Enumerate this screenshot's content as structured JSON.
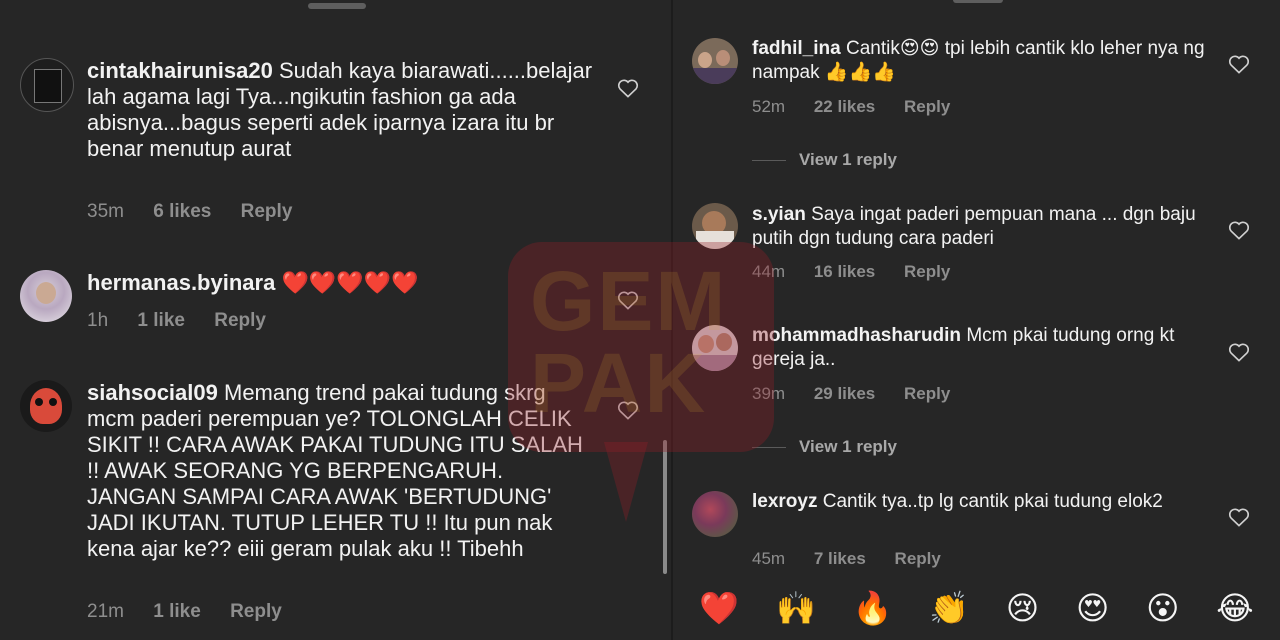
{
  "left": {
    "comments": [
      {
        "username": "cintakhairunisa20",
        "text": "Sudah kaya biarawati......belajar lah agama lagi Tya...ngikutin fashion  ga ada abisnya...bagus seperti adek iparnya izara itu br benar menutup aurat",
        "time": "35m",
        "likes": "6 likes",
        "reply": "Reply"
      },
      {
        "username": "hermanas.byinara",
        "text": "❤️❤️❤️❤️❤️",
        "time": "1h",
        "likes": "1 like",
        "reply": "Reply"
      },
      {
        "username": "siahsocial09",
        "text": "Memang trend pakai tudung skrg mcm paderi perempuan ye? TOLONGLAH CELIK SIKIT !! CARA AWAK PAKAI TUDUNG ITU  SALAH !! AWAK SEORANG YG BERPENGARUH. JANGAN SAMPAI CARA AWAK 'BERTUDUNG' JADI IKUTAN. TUTUP LEHER TU !! Itu pun nak kena ajar ke?? eiii geram pulak aku !! Tibehh",
        "time": "21m",
        "likes": "1 like",
        "reply": "Reply"
      }
    ]
  },
  "right": {
    "comments": [
      {
        "username": "fadhil_ina",
        "text": "Cantik😍😍 tpi lebih cantik klo leher nya ng nampak 👍👍👍",
        "time": "52m",
        "likes": "22 likes",
        "reply": "Reply",
        "view_replies": "View 1 reply"
      },
      {
        "username": "s.yian",
        "text": "Saya ingat paderi pempuan mana ... dgn baju putih dgn tudung cara paderi",
        "time": "44m",
        "likes": "16 likes",
        "reply": "Reply"
      },
      {
        "username": "mohammadhasharudin",
        "text": "Mcm pkai tudung orng kt  gereja ja..",
        "time": "39m",
        "likes": "29 likes",
        "reply": "Reply",
        "view_replies": "View 1 reply"
      },
      {
        "username": "lexroyz",
        "text": "Cantik tya..tp lg cantik pkai tudung elok2",
        "time": "45m",
        "likes": "7 likes",
        "reply": "Reply"
      }
    ],
    "reactions": [
      "❤️",
      "🙌",
      "🔥",
      "👏",
      "😢",
      "😍",
      "😮",
      "😂"
    ]
  },
  "watermark": {
    "text": "GEM PAK"
  },
  "colors": {
    "background": "#262626",
    "meta_text": "#8e8e8e",
    "watermark": "#961e28"
  },
  "icons": {
    "like": "heart-outline-icon"
  }
}
